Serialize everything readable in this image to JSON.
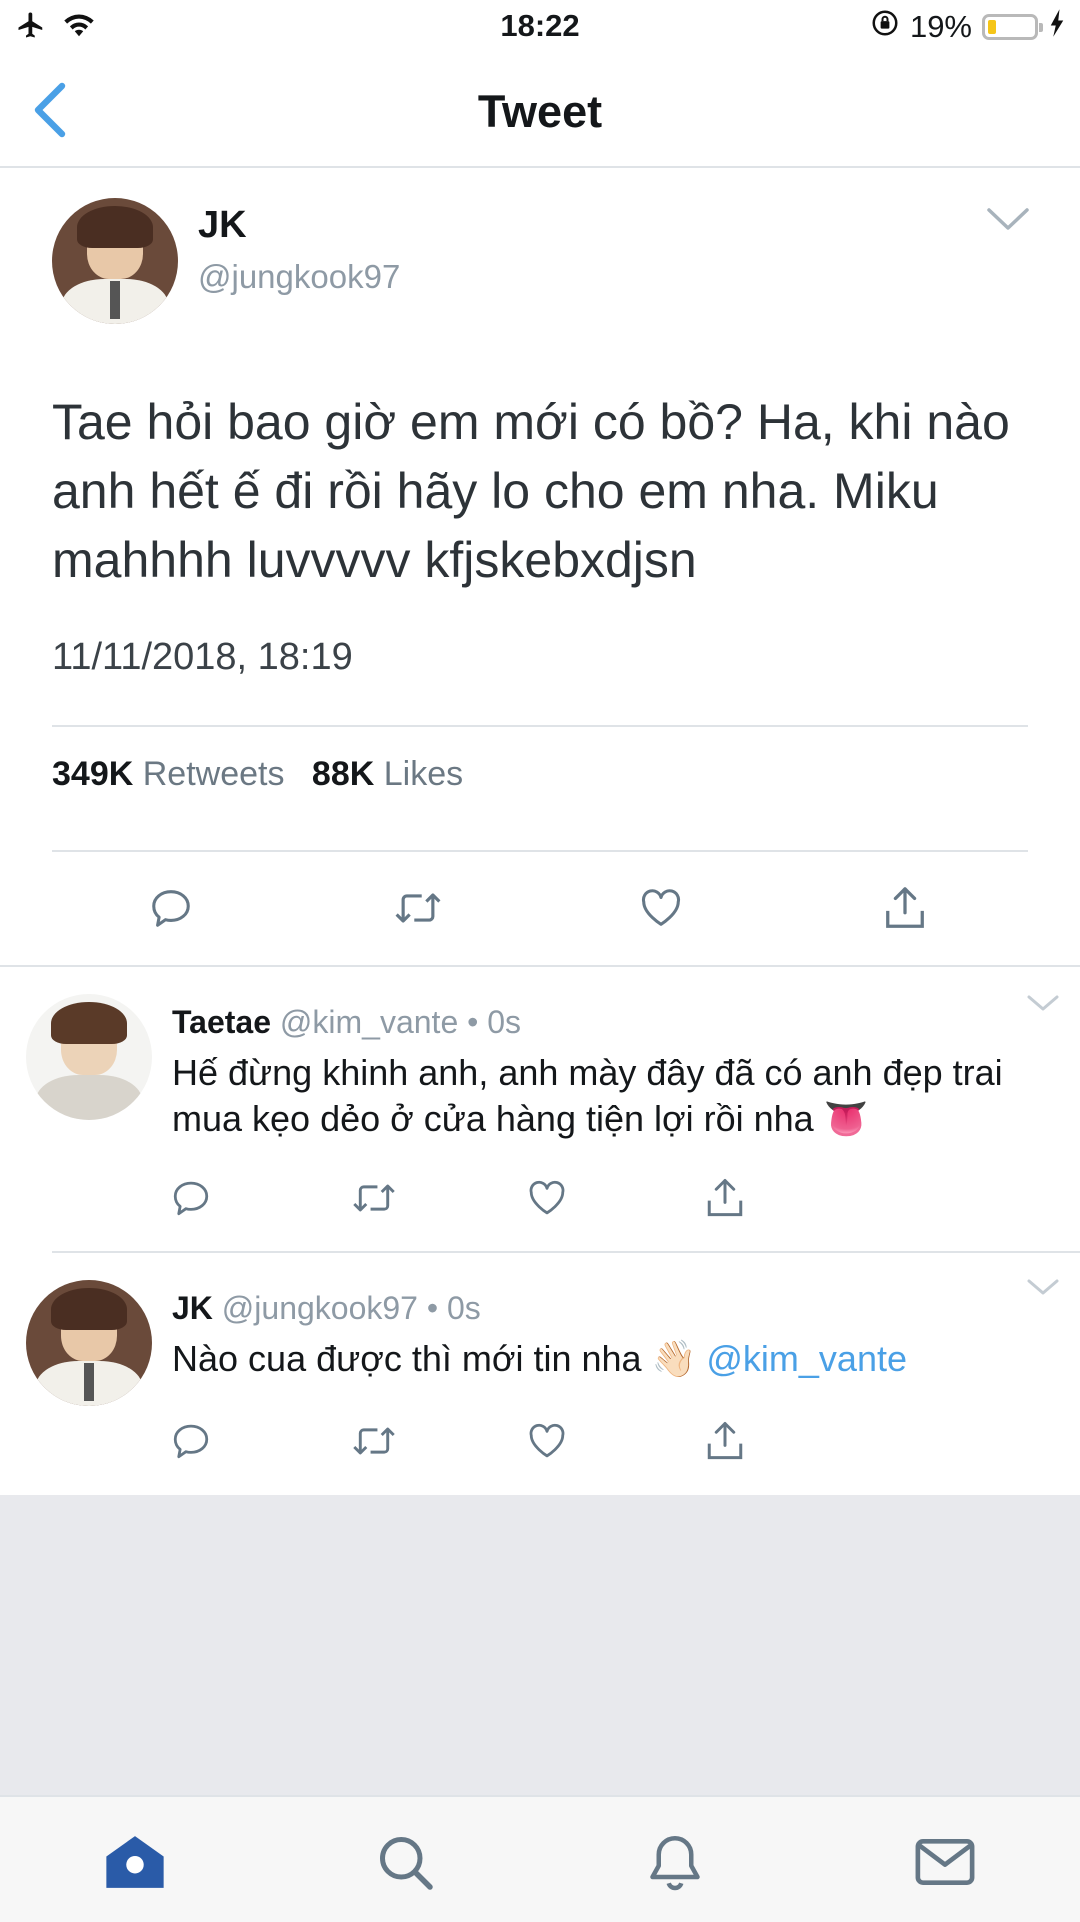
{
  "status_bar": {
    "time": "18:22",
    "battery_percent": "19%",
    "battery_level": 0.19
  },
  "nav": {
    "title": "Tweet"
  },
  "main_tweet": {
    "name": "JK",
    "handle": "@jungkook97",
    "text": "Tae hỏi bao giờ em mới có bồ? Ha, khi nào anh hết ế đi rồi hãy lo cho em nha. Miku mahhhh luvvvvv kfjskebxdjsn",
    "timestamp": "11/11/2018, 18:19",
    "retweets_count": "349K",
    "retweets_label": "Retweets",
    "likes_count": "88K",
    "likes_label": "Likes"
  },
  "replies": [
    {
      "name": "Taetae",
      "handle": "@kim_vante",
      "time": "0s",
      "text": "Hế đừng khinh anh, anh mày đây đã có anh đẹp trai mua kẹo dẻo ở cửa hàng tiện lợi rồi nha 👅"
    },
    {
      "name": "JK",
      "handle": "@jungkook97",
      "time": "0s",
      "text": "Nào cua được thì mới tin nha 👋🏻",
      "mention": "@kim_vante"
    }
  ],
  "separator": "•",
  "icons": {
    "status_left": [
      "airplane-icon",
      "wifi-icon"
    ],
    "status_right": [
      "orientation-lock-icon",
      "battery-icon",
      "charging-icon"
    ],
    "tweet_actions": [
      "reply-icon",
      "retweet-icon",
      "like-icon",
      "share-icon"
    ],
    "tab_bar": [
      "home-icon",
      "search-icon",
      "notifications-icon",
      "messages-icon"
    ]
  },
  "colors": {
    "accent": "#4aa0e6",
    "tab_active": "#2a5ba8",
    "muted_text": "#8e9aa5",
    "battery_fill": "#f5c518"
  }
}
